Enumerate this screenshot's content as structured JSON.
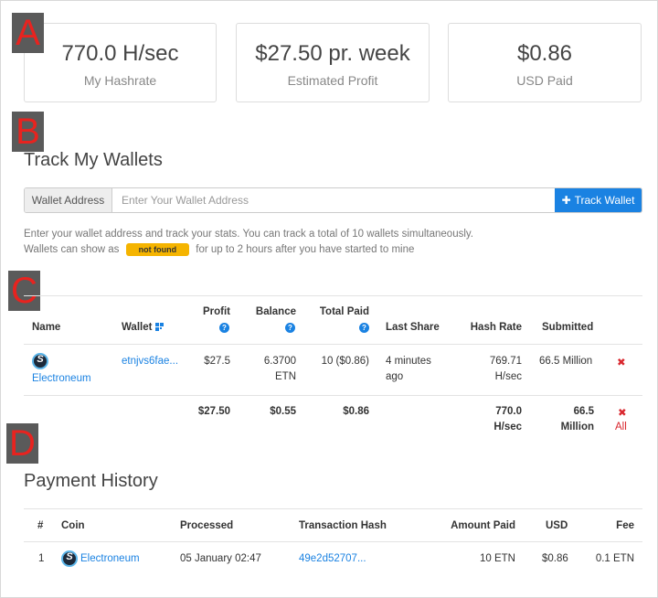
{
  "stats": [
    {
      "value": "770.0 H/sec",
      "label": "My Hashrate"
    },
    {
      "value": "$27.50 pr. week",
      "label": "Estimated Profit"
    },
    {
      "value": "$0.86",
      "label": "USD Paid"
    }
  ],
  "markers": [
    "A",
    "B",
    "C",
    "D"
  ],
  "track": {
    "title": "Track My Wallets",
    "addon_label": "Wallet Address",
    "placeholder": "Enter Your Wallet Address",
    "value": "",
    "button_label": "Track Wallet",
    "help_line1": "Enter your wallet address and track your stats. You can track a total of 10 wallets simultaneously.",
    "help_line2_before": "Wallets can show as",
    "help_badge": "not found",
    "help_line2_after": "for up to 2 hours after you have started to mine"
  },
  "wallets": {
    "headers": {
      "name": "Name",
      "wallet": "Wallet",
      "profit": "Profit",
      "balance": "Balance",
      "total_paid": "Total Paid",
      "last_share": "Last Share",
      "hash_rate": "Hash Rate",
      "submitted": "Submitted"
    },
    "row": {
      "name": "Electroneum",
      "wallet": "etnjvs6fae...",
      "profit": "$27.5",
      "balance_line1": "6.3700",
      "balance_line2": "ETN",
      "total_paid": "10 ($0.86)",
      "last_share_line1": "4 minutes",
      "last_share_line2": "ago",
      "hash_rate_line1": "769.71",
      "hash_rate_line2": "H/sec",
      "submitted": "66.5 Million",
      "remove": "✖"
    },
    "totals": {
      "profit": "$27.50",
      "balance": "$0.55",
      "total_paid": "$0.86",
      "hash_rate_line1": "770.0",
      "hash_rate_line2": "H/sec",
      "submitted_line1": "66.5",
      "submitted_line2": "Million",
      "remove": "✖",
      "remove_all": "All"
    }
  },
  "payments": {
    "title": "Payment History",
    "headers": {
      "num": "#",
      "coin": "Coin",
      "processed": "Processed",
      "hash": "Transaction Hash",
      "amount": "Amount Paid",
      "usd": "USD",
      "fee": "Fee"
    },
    "rows": [
      {
        "num": "1",
        "coin": "Electroneum",
        "processed": "05 January 02:47",
        "hash": "49e2d52707...",
        "amount": "10 ETN",
        "usd": "$0.86",
        "fee": "0.1 ETN"
      }
    ]
  },
  "colors": {
    "accent": "#1a82e2",
    "danger": "#d9272e",
    "badge": "#f5b400",
    "marker_bg": "#5a5a5a",
    "marker_fg": "#e8231f"
  }
}
